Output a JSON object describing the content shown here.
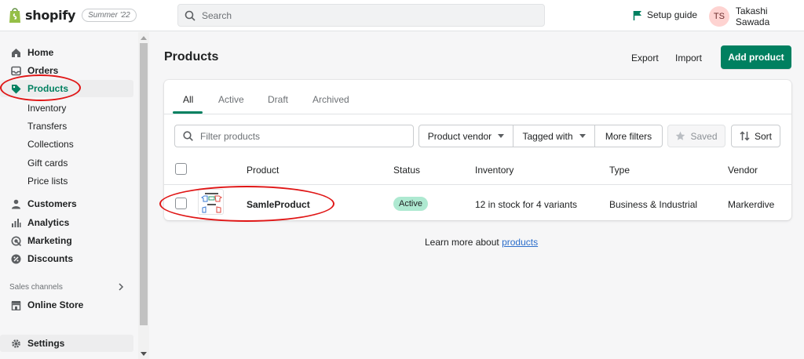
{
  "topbar": {
    "brand": "shopify",
    "edition": "Summer '22",
    "search_placeholder": "Search",
    "setup_guide": "Setup guide",
    "user_initials": "TS",
    "user_name": "Takashi Sawada"
  },
  "sidebar": {
    "items": [
      {
        "label": "Home",
        "icon": "home-icon"
      },
      {
        "label": "Orders",
        "icon": "orders-icon"
      },
      {
        "label": "Products",
        "icon": "tag-icon",
        "active": true
      },
      {
        "label": "Customers",
        "icon": "person-icon"
      },
      {
        "label": "Analytics",
        "icon": "analytics-icon"
      },
      {
        "label": "Marketing",
        "icon": "marketing-icon"
      },
      {
        "label": "Discounts",
        "icon": "discount-icon"
      }
    ],
    "product_subitems": [
      "Inventory",
      "Transfers",
      "Collections",
      "Gift cards",
      "Price lists"
    ],
    "sales_channels_label": "Sales channels",
    "online_store": "Online Store",
    "settings": "Settings"
  },
  "main": {
    "title": "Products",
    "export_label": "Export",
    "import_label": "Import",
    "add_product_label": "Add product",
    "tabs": [
      "All",
      "Active",
      "Draft",
      "Archived"
    ],
    "filter_placeholder": "Filter products",
    "filters": {
      "vendor": "Product vendor",
      "tagged": "Tagged with",
      "more": "More filters",
      "saved": "Saved",
      "sort": "Sort"
    },
    "columns": [
      "Product",
      "Status",
      "Inventory",
      "Type",
      "Vendor"
    ],
    "rows": [
      {
        "name": "SamleProduct",
        "status": "Active",
        "inventory": "12 in stock for 4 variants",
        "type": "Business & Industrial",
        "vendor": "Markerdive"
      }
    ],
    "learn_more_prefix": "Learn more about ",
    "learn_more_link": "products"
  },
  "colors": {
    "accent": "#008060",
    "active_badge": "#aee9d1",
    "annotation": "#e01616"
  }
}
